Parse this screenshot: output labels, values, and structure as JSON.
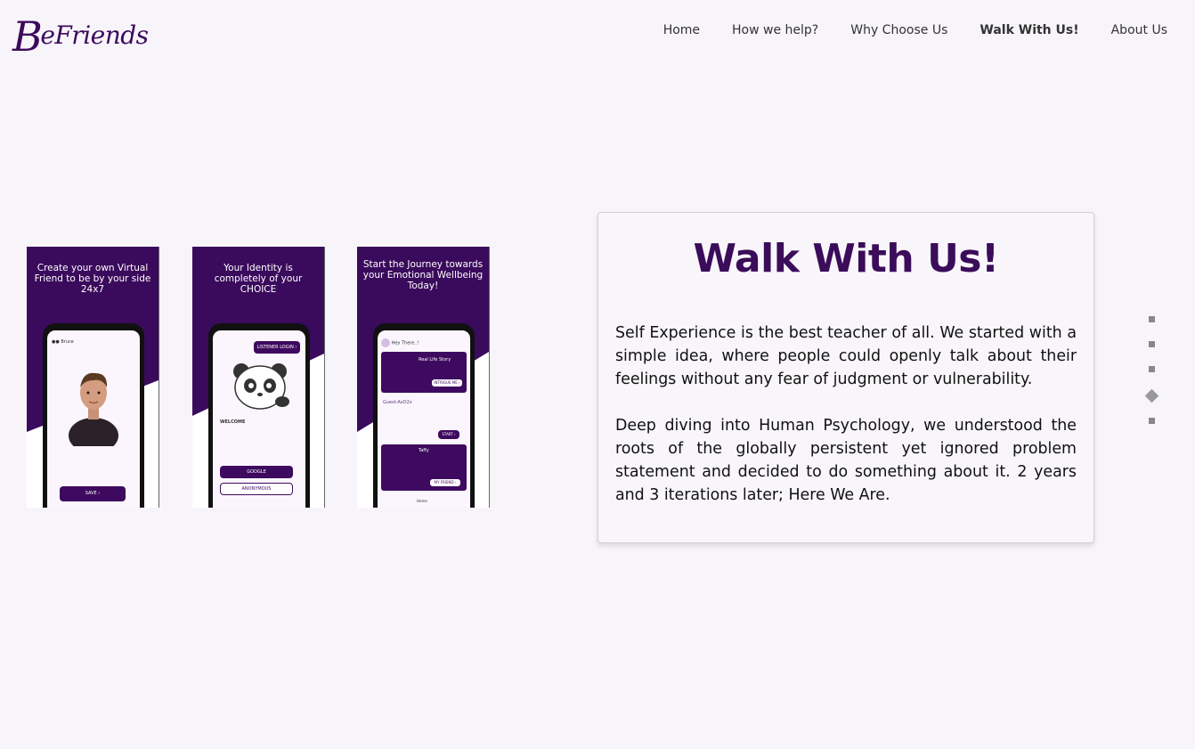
{
  "brand": {
    "logo_first": "B",
    "logo_rest": "eFriends",
    "color": "#3c0a5c"
  },
  "nav": {
    "items": [
      {
        "label": "Home"
      },
      {
        "label": "How we help?"
      },
      {
        "label": "Why Choose Us"
      },
      {
        "label": "Walk With Us!",
        "active": true
      },
      {
        "label": "About Us"
      }
    ]
  },
  "screenshots": [
    {
      "caption": "Create your own Virtual Friend to be by your side 24x7",
      "app_user": "Bruce",
      "button": "SAVE ›"
    },
    {
      "caption": "Your Identity is completely of your CHOICE",
      "listener_button": "LISTENER LOGIN ›",
      "welcome": "WELCOME",
      "google_button": "GOOGLE",
      "anonymous_button": "ANONYMOUS"
    },
    {
      "caption": "Start the Journey towards your Emotional Wellbeing Today!",
      "greeting": "Hey There..!",
      "story_title": "Real Life Story",
      "intrigue_button": "INTRIGUE ME ›",
      "guest": "Guest-AxD2v",
      "start_button": "START ›",
      "friend_name": "Taffy",
      "friend_button": "MY FRIEND ›",
      "tab_home": "Home"
    }
  ],
  "section": {
    "title": "Walk With Us!",
    "paragraph1": "Self Experience is the best teacher of all. We started with a simple idea, where people could openly talk about their feelings without any fear of judgment or vulnerability.",
    "paragraph2": "Deep diving into Human Psychology, we understood the roots of the globally persistent yet ignored problem statement and decided to do something about it. 2 years and 3 iterations later; Here We Are."
  },
  "pager": {
    "count": 5,
    "active_index": 3
  },
  "colors": {
    "accent": "#3b0c5a",
    "page_bg": "#f8f5fa"
  }
}
